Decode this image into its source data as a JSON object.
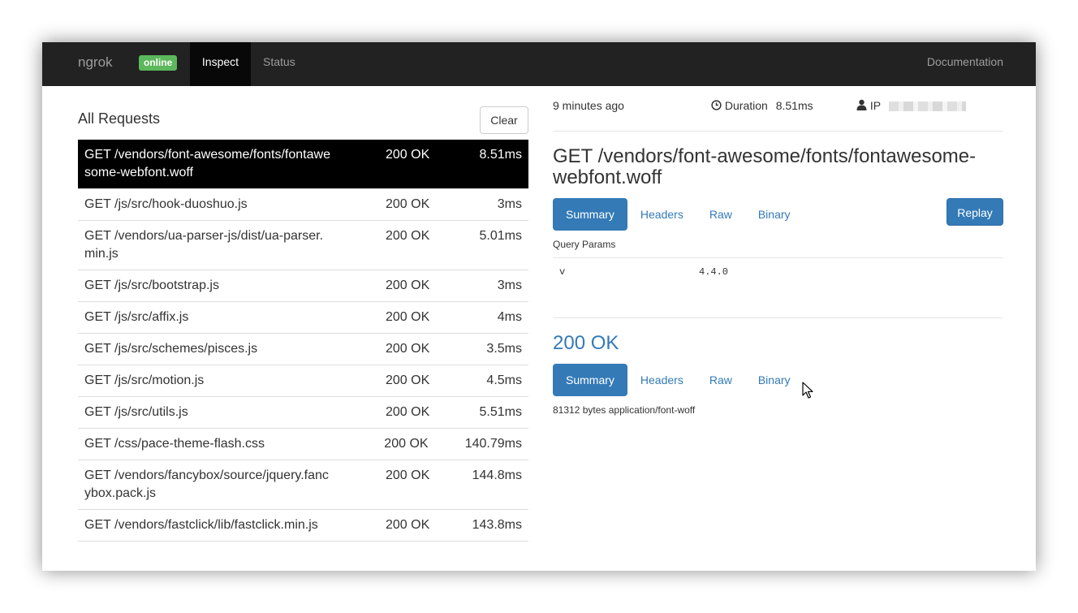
{
  "navbar": {
    "brand": "ngrok",
    "online_badge": "online",
    "tabs": [
      {
        "label": "Inspect",
        "active": true
      },
      {
        "label": "Status",
        "active": false
      }
    ],
    "documentation": "Documentation"
  },
  "requests_panel": {
    "title": "All Requests",
    "clear_label": "Clear",
    "rows": [
      {
        "path": "GET /vendors/font-awesome/fonts/fontawesome-webfont.woff",
        "status": "200 OK",
        "duration": "8.51ms",
        "selected": true
      },
      {
        "path": "GET /js/src/hook-duoshuo.js",
        "status": "200 OK",
        "duration": "3ms"
      },
      {
        "path": "GET /vendors/ua-parser-js/dist/ua-parser.min.js",
        "status": "200 OK",
        "duration": "5.01ms"
      },
      {
        "path": "GET /js/src/bootstrap.js",
        "status": "200 OK",
        "duration": "3ms"
      },
      {
        "path": "GET /js/src/affix.js",
        "status": "200 OK",
        "duration": "4ms"
      },
      {
        "path": "GET /js/src/schemes/pisces.js",
        "status": "200 OK",
        "duration": "3.5ms"
      },
      {
        "path": "GET /js/src/motion.js",
        "status": "200 OK",
        "duration": "4.5ms"
      },
      {
        "path": "GET /js/src/utils.js",
        "status": "200 OK",
        "duration": "5.51ms"
      },
      {
        "path": "GET /css/pace-theme-flash.css",
        "status": "200 OK",
        "duration": "140.79ms"
      },
      {
        "path": "GET /vendors/fancybox/source/jquery.fancybox.pack.js",
        "status": "200 OK",
        "duration": "144.8ms"
      },
      {
        "path": "GET /vendors/fastclick/lib/fastclick.min.js",
        "status": "200 OK",
        "duration": "143.8ms"
      }
    ]
  },
  "detail": {
    "time_ago": "9 minutes ago",
    "duration_label": "Duration",
    "duration_value": "8.51ms",
    "ip_label": "IP",
    "request_title": "GET /vendors/font-awesome/fonts/fontawesome-webfont.woff",
    "request_tabs": [
      "Summary",
      "Headers",
      "Raw",
      "Binary"
    ],
    "replay_label": "Replay",
    "query_params_label": "Query Params",
    "query_params": [
      {
        "key": "v",
        "value": "4.4.0"
      }
    ],
    "response_status": "200 OK",
    "response_tabs": [
      "Summary",
      "Headers",
      "Raw",
      "Binary"
    ],
    "response_summary": "81312 bytes application/font-woff"
  },
  "icons": {
    "clock": "clock-icon",
    "user": "user-icon",
    "cursor": "mouse-cursor-icon"
  },
  "colors": {
    "navbar_bg": "#222222",
    "online_badge": "#5cb85c",
    "primary": "#337ab7",
    "selected_row": "#000000"
  }
}
